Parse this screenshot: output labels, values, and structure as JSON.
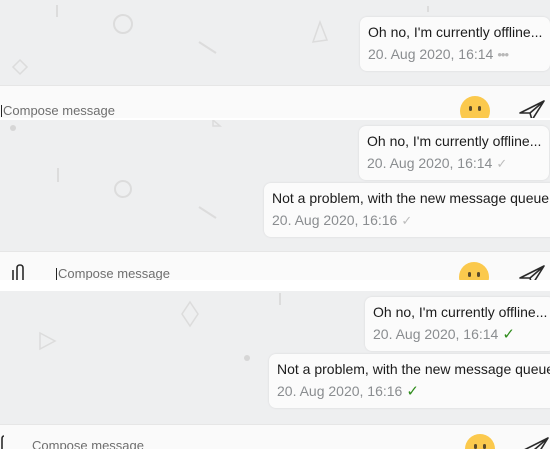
{
  "colors": {
    "chat_background": "#eeeff0",
    "bubble": "#fbfbfb",
    "delivered_check": "#2f8c1c",
    "pending_dots": "#b8b8b8",
    "emoji": "#fbc94d"
  },
  "compose": {
    "placeholder": "Compose message",
    "emoji_icon": "smiley-face-icon",
    "send_icon": "paper-plane-icon",
    "attach_icon": "paperclip-icon"
  },
  "panels": [
    {
      "messages": [
        {
          "text": "Oh no, I'm currently offline...",
          "time": "20. Aug 2020, 16:14",
          "status": "•••"
        }
      ]
    },
    {
      "messages": [
        {
          "text": "Oh no, I'm currently offline...",
          "time": "20. Aug 2020, 16:14",
          "status": "✓"
        },
        {
          "text": "Not a problem, with the new message queue!",
          "time": "20. Aug 2020, 16:16",
          "status": "✓"
        }
      ]
    },
    {
      "messages": [
        {
          "text": "Oh no, I'm currently offline...",
          "time": "20. Aug 2020, 16:14",
          "status": "✓"
        },
        {
          "text": "Not a problem, with the new message queue!",
          "time": "20. Aug 2020, 16:16",
          "status": "✓"
        }
      ]
    }
  ]
}
